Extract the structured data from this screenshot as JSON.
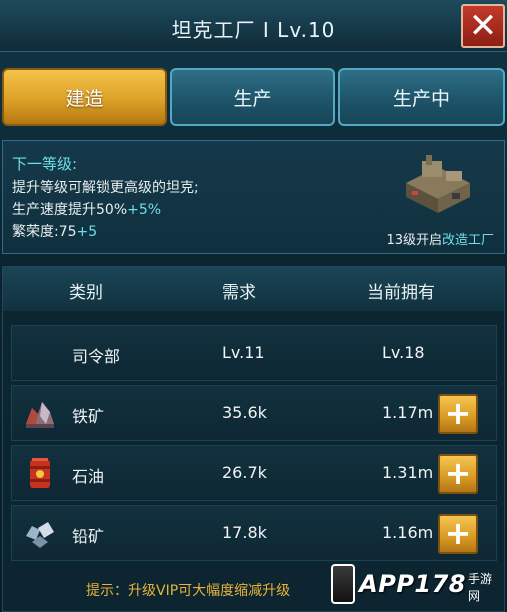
{
  "header": {
    "title": "坦克工厂 I  Lv.10",
    "close_icon": "close-icon"
  },
  "tabs": [
    {
      "label": "建造",
      "active": true
    },
    {
      "label": "生产",
      "active": false
    },
    {
      "label": "生产中",
      "active": false
    }
  ],
  "info": {
    "heading": "下一等级:",
    "line1": "提升等级可解锁更高级的坦克;",
    "line2_text": "生产速度提升50%",
    "line2_bonus": "+5%",
    "line3_text": "繁荣度:75",
    "line3_bonus": "+5",
    "unlock_prefix": "13级开启",
    "unlock_target": "改造工厂",
    "factory_icon": "factory-building-icon"
  },
  "table": {
    "headers": [
      "类别",
      "需求",
      "当前拥有"
    ],
    "rows": [
      {
        "icon": "",
        "name": "司令部",
        "required": "Lv.11",
        "owned": "Lv.18",
        "add_button": false
      },
      {
        "icon": "iron-ore-icon",
        "name": "铁矿",
        "required": "35.6k",
        "owned": "1.17m",
        "add_button": true
      },
      {
        "icon": "oil-barrel-icon",
        "name": "石油",
        "required": "26.7k",
        "owned": "1.31m",
        "add_button": true
      },
      {
        "icon": "lead-ore-icon",
        "name": "铅矿",
        "required": "17.8k",
        "owned": "1.16m",
        "add_button": true
      }
    ],
    "plus_label": "+"
  },
  "tip": "提示：升级VIP可大幅度缩减升级",
  "watermark": {
    "main": "APP178",
    "sub": "手游网"
  },
  "colors": {
    "accent_cyan": "#6fdfe8",
    "gold": "#dea228",
    "tip": "#e8b33a"
  }
}
